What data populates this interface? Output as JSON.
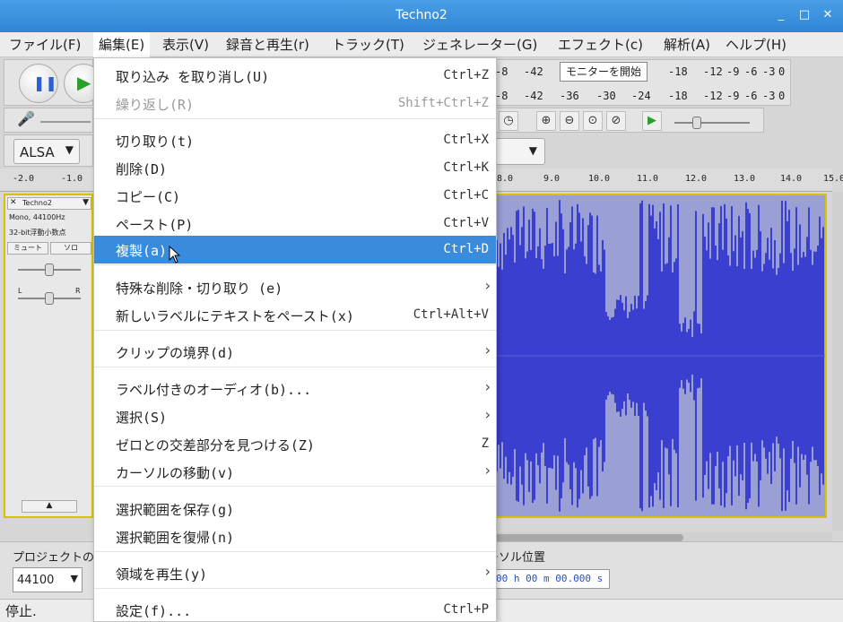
{
  "window": {
    "title": "Techno2"
  },
  "menubar": [
    "ファイル(F)",
    "編集(E)",
    "表示(V)",
    "録音と再生(r)",
    "トラック(T)",
    "ジェネレーター(G)",
    "エフェクト(c)",
    "解析(A)",
    "ヘルプ(H)"
  ],
  "meter": {
    "rec_ticks": [
      "-8",
      "-42",
      "-18",
      "-12",
      "-9",
      "-6",
      "-3",
      "0"
    ],
    "play_ticks": [
      "-8",
      "-42",
      "-36",
      "-30",
      "-24",
      "-18",
      "-12",
      "-9",
      "-6",
      "-3",
      "0"
    ],
    "monitor_label": "モニターを開始"
  },
  "device": {
    "host": "ALSA"
  },
  "ruler": [
    "-2.0",
    "-1.0",
    "8.0",
    "9.0",
    "10.0",
    "11.0",
    "12.0",
    "13.0",
    "14.0",
    "15.0"
  ],
  "track": {
    "name": "Techno2",
    "info1": "Mono, 44100Hz",
    "info2": "32-bit浮動小数点",
    "mute": "ミュート",
    "solo": "ソロ",
    "pan_l": "L",
    "pan_r": "R"
  },
  "bottom": {
    "project_rate_label": "プロジェクトのサ",
    "rate_value": "44100",
    "position_label": "カーソル位置",
    "time_text": "00 h 00 m 00.000 s"
  },
  "status": {
    "text": "停止."
  },
  "edit_menu": {
    "items": [
      {
        "label": "取り込み を取り消し(U)",
        "shortcut": "Ctrl+Z"
      },
      {
        "label": "繰り返し(R)",
        "shortcut": "Shift+Ctrl+Z",
        "disabled": true
      },
      {
        "label": "切り取り(t)",
        "shortcut": "Ctrl+X"
      },
      {
        "label": "削除(D)",
        "shortcut": "Ctrl+K"
      },
      {
        "label": "コピー(C)",
        "shortcut": "Ctrl+C"
      },
      {
        "label": "ペースト(P)",
        "shortcut": "Ctrl+V"
      },
      {
        "label": "複製(a)",
        "shortcut": "Ctrl+D",
        "highlighted": true
      },
      {
        "label": "特殊な削除・切り取り (e)",
        "submenu": true
      },
      {
        "label": "新しいラベルにテキストをペースト(x)",
        "shortcut": "Ctrl+Alt+V"
      },
      {
        "label": "クリップの境界(d)",
        "submenu": true
      },
      {
        "label": "ラベル付きのオーディオ(b)...",
        "submenu": true
      },
      {
        "label": "選択(S)",
        "submenu": true
      },
      {
        "label": "ゼロとの交差部分を見つける(Z)",
        "shortcut": "Z"
      },
      {
        "label": "カーソルの移動(v)",
        "submenu": true
      },
      {
        "label": "選択範囲を保存(g)"
      },
      {
        "label": "選択範囲を復帰(n)"
      },
      {
        "label": "領域を再生(y)",
        "submenu": true
      },
      {
        "label": "設定(f)...",
        "shortcut": "Ctrl+P"
      }
    ]
  },
  "colors": {
    "accent": "#3a8bdb",
    "waveform": "#3b3fd0",
    "selection_border": "#d4c400"
  }
}
